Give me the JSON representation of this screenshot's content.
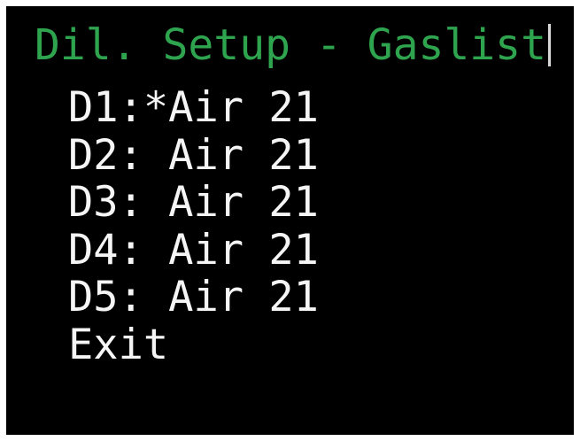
{
  "screen": {
    "title": "Dil. Setup - Gaslist",
    "menu": {
      "items": [
        {
          "label": "D1:*Air 21"
        },
        {
          "label": "D2: Air 21"
        },
        {
          "label": "D3: Air 21"
        },
        {
          "label": "D4: Air 21"
        },
        {
          "label": "D5: Air 21"
        },
        {
          "label": "Exit"
        }
      ]
    }
  },
  "colors": {
    "background": "#000000",
    "title": "#2fa44f",
    "text": "#f5f5f5",
    "cursor": "#d8d8d8"
  }
}
